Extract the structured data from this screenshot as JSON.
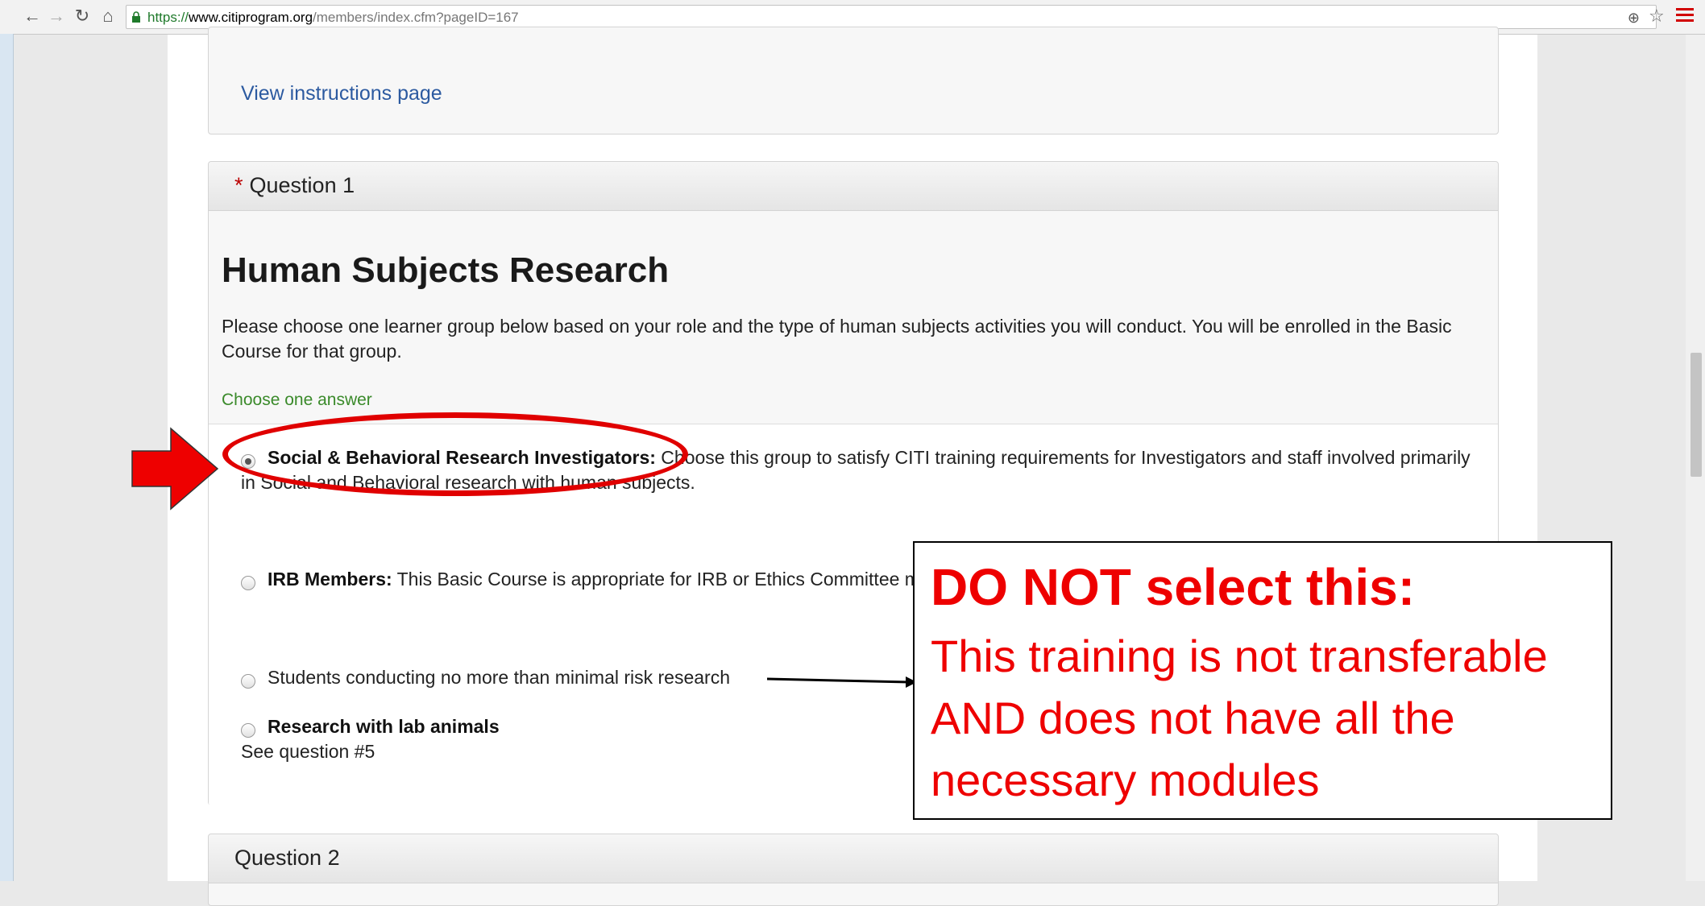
{
  "browser": {
    "url_scheme": "https://",
    "url_host": "www.citiprogram.org",
    "url_path": "/members/index.cfm?pageID=167"
  },
  "instructions_panel": {
    "link_label": "View instructions page"
  },
  "question1": {
    "required_marker": "*",
    "label": "Question 1",
    "heading": "Human Subjects Research",
    "intro": "Please choose one learner group below based on your role and the type of human subjects activities you will conduct. You will be enrolled in the Basic Course for that group.",
    "hint": "Choose one answer",
    "answers": [
      {
        "bold": "Social & Behavioral Research Investigators:",
        "text": " Choose this group to satisfy CITI training requirements for Investigators and staff involved primarily in Social and Behavioral research with human subjects.",
        "checked": true
      },
      {
        "bold": "IRB Members:",
        "text": " This Basic Course is appropriate for IRB or Ethics Committee members.",
        "checked": false
      },
      {
        "bold": "",
        "text": "Students conducting no more than minimal risk research",
        "checked": false
      },
      {
        "bold": "Research with lab animals",
        "text": "",
        "sub": "See question #5",
        "checked": false
      }
    ]
  },
  "question2": {
    "label": "Question 2"
  },
  "callout": {
    "title": "DO NOT select this:",
    "body": "This training is not transferable AND does not have all the necessary modules"
  },
  "colors": {
    "annotation_red": "#ee0000",
    "link_blue": "#2c5aa0",
    "hint_green": "#3a8a2a"
  }
}
